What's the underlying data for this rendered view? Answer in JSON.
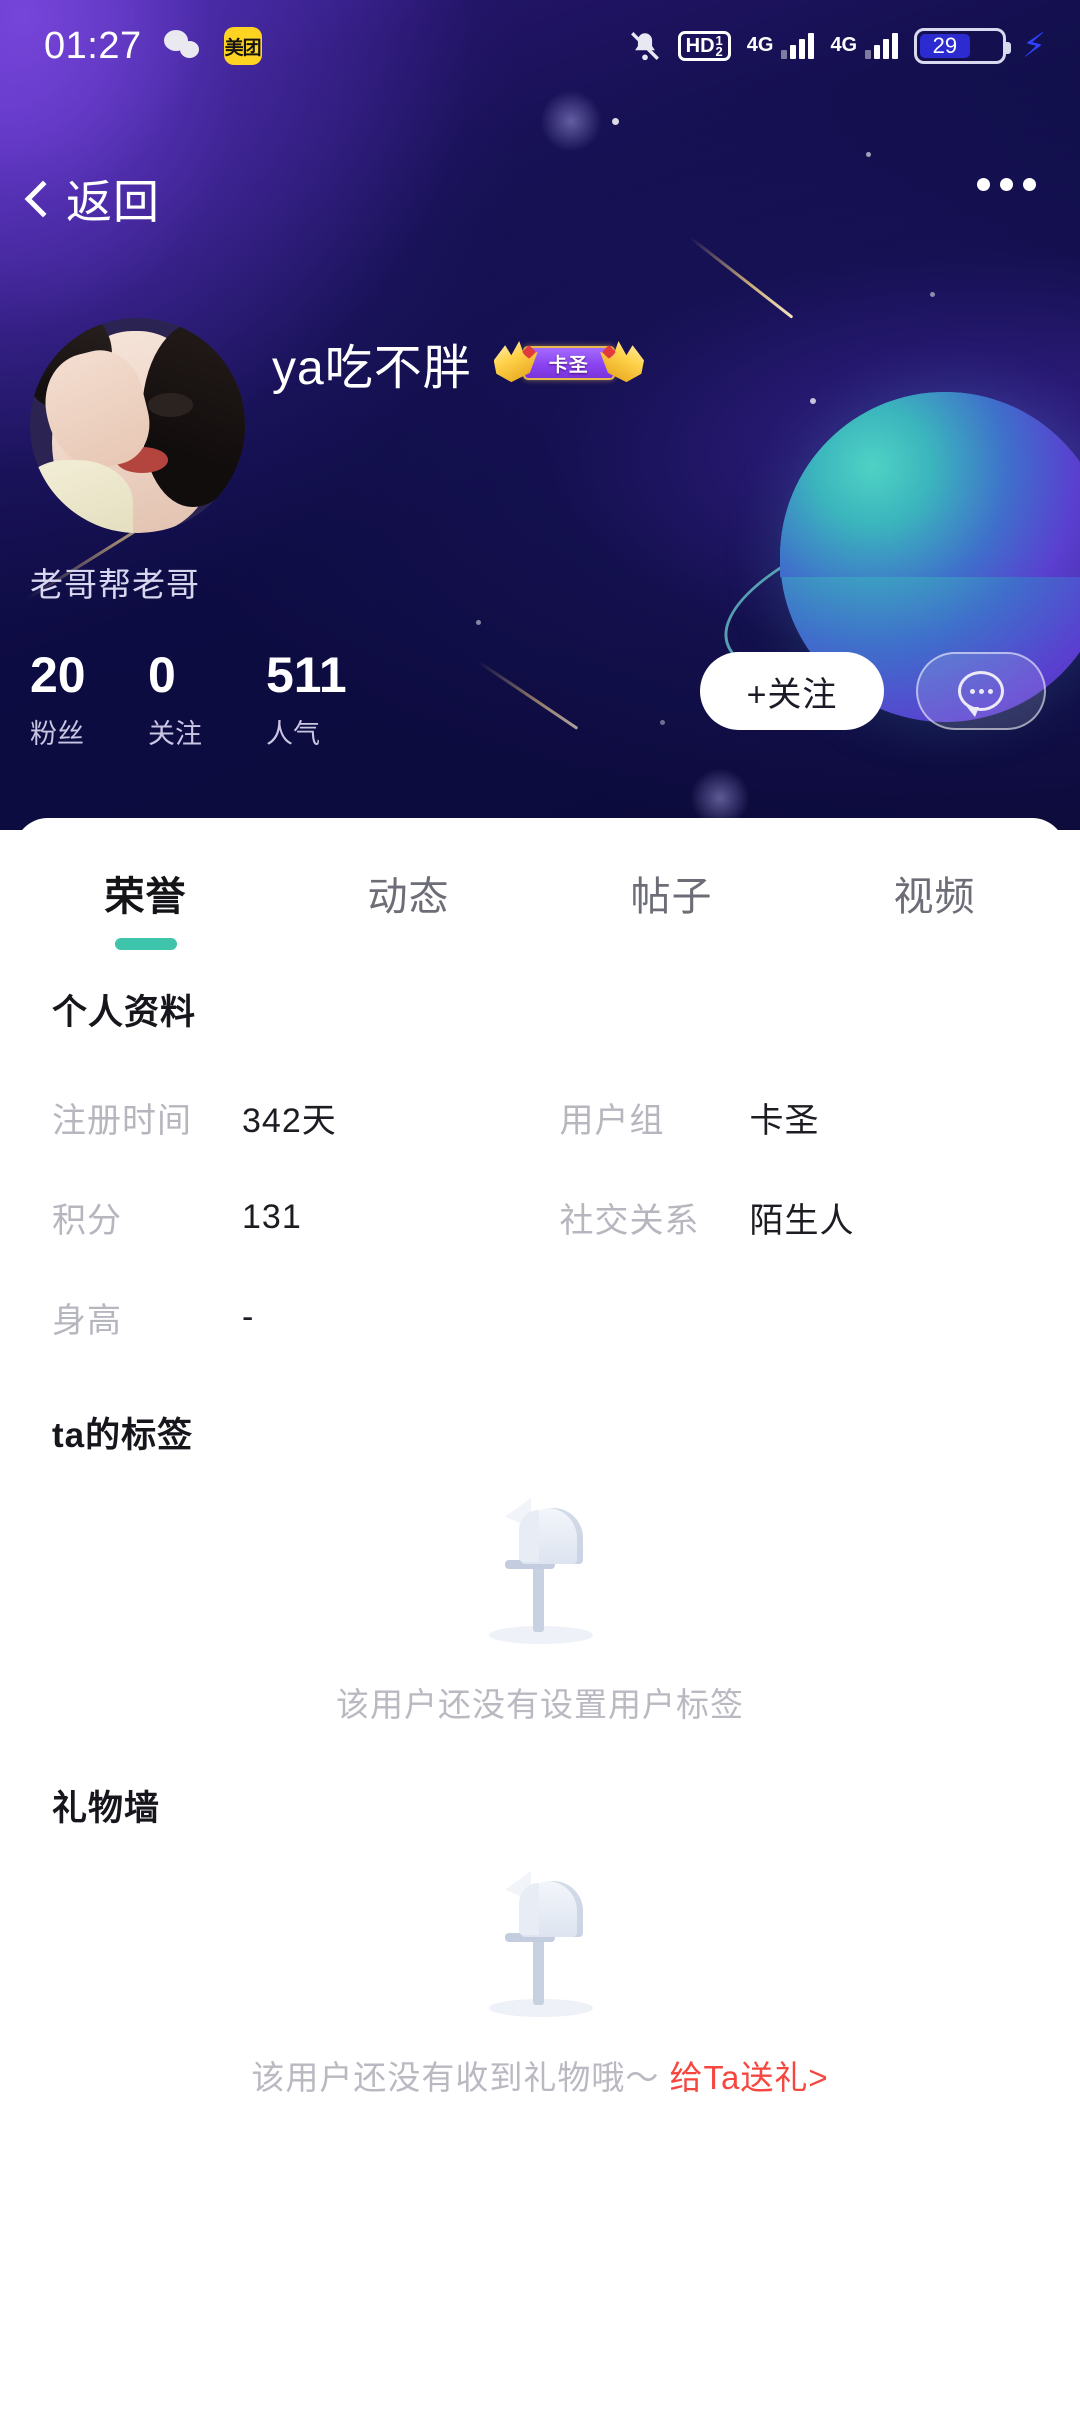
{
  "status_bar": {
    "time": "01:27",
    "icons_left": [
      "wechat-icon",
      "meituan-icon"
    ],
    "meituan_label": "美团",
    "icons_right": [
      "bell-mute-icon",
      "hd-voice-icon",
      "signal-4g-sim1-icon",
      "signal-4g-sim2-icon",
      "battery-icon",
      "charging-bolt-icon"
    ],
    "hd_label": "HD",
    "hd_sup": "1",
    "hd_sub": "2",
    "network_1": "4G",
    "network_2": "4G",
    "battery_percent": "29"
  },
  "navbar": {
    "back_label": "返回",
    "more_icon": "more-dots-icon"
  },
  "profile": {
    "avatar_alt": "user-avatar",
    "username": "ya吃不胖",
    "badge_label": "卡圣",
    "signature": "老哥帮老哥",
    "stats": [
      {
        "num": "20",
        "label": "粉丝"
      },
      {
        "num": "0",
        "label": "关注"
      },
      {
        "num": "511",
        "label": "人气"
      }
    ],
    "follow_label": "+关注",
    "message_icon": "chat-bubble-icon"
  },
  "tabs": [
    {
      "label": "荣誉",
      "active": true
    },
    {
      "label": "动态",
      "active": false
    },
    {
      "label": "帖子",
      "active": false
    },
    {
      "label": "视频",
      "active": false
    }
  ],
  "personal_info": {
    "title": "个人资料",
    "rows": [
      {
        "k1": "注册时间",
        "v1": "342天",
        "k2": "用户组",
        "v2": "卡圣"
      },
      {
        "k1": "积分",
        "v1": "131",
        "k2": "社交关系",
        "v2": "陌生人"
      },
      {
        "k1": "身高",
        "v1": "-",
        "k2": "",
        "v2": ""
      }
    ]
  },
  "tags_section": {
    "title": "ta的标签",
    "empty_icon": "mailbox-empty-icon",
    "empty_text": "该用户还没有设置用户标签"
  },
  "gift_section": {
    "title": "礼物墙",
    "empty_icon": "mailbox-empty-icon",
    "empty_text": "该用户还没有收到礼物哦～",
    "gift_link": "给Ta送礼>"
  },
  "colors": {
    "accent_teal": "#3ec4aa",
    "link_red": "#f5473f",
    "hero_purple": "#3a2499",
    "hero_navy": "#0c0b3a",
    "badge_purple": "#8a44f0",
    "badge_gold": "#ffd24a"
  }
}
